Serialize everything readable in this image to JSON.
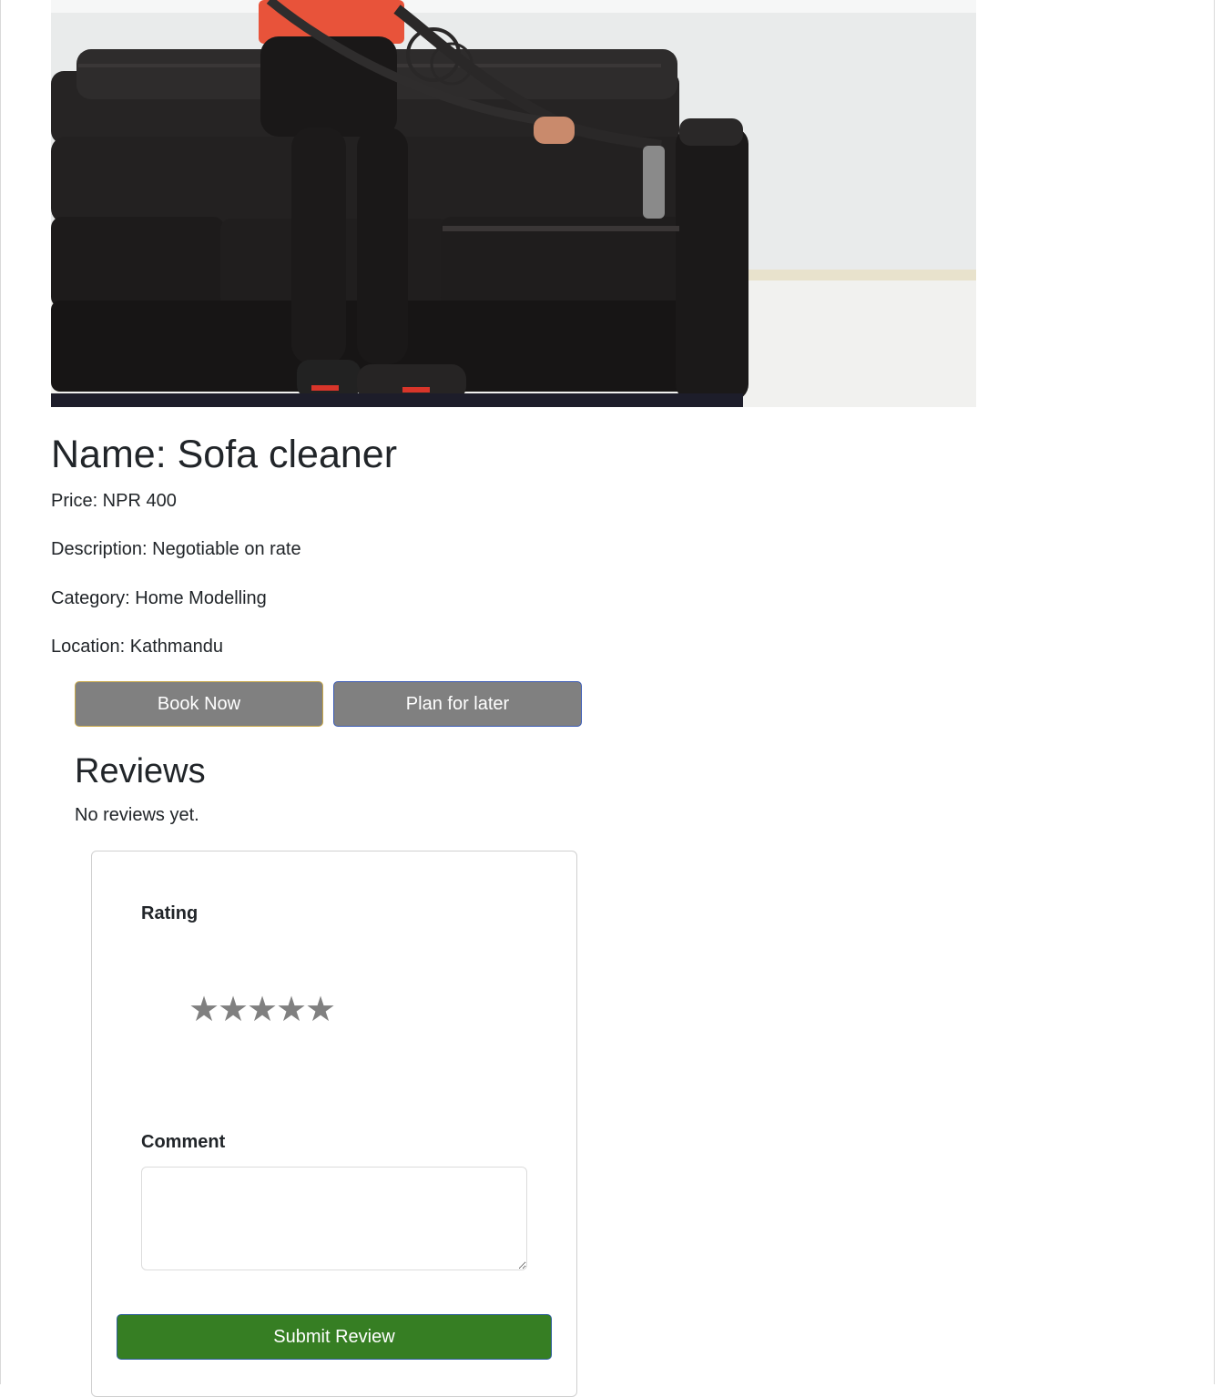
{
  "product": {
    "name": "Name: Sofa cleaner",
    "price": "Price: NPR 400",
    "description": "Description: Negotiable on rate",
    "category": "Category: Home Modelling",
    "location": "Location: Kathmandu"
  },
  "actions": {
    "book_label": "Book Now",
    "plan_label": "Plan for later"
  },
  "reviews": {
    "title": "Reviews",
    "empty_text": "No reviews yet."
  },
  "review_form": {
    "rating_label": "Rating",
    "stars": [
      "★",
      "★",
      "★",
      "★",
      "★"
    ],
    "comment_label": "Comment",
    "comment_value": "",
    "submit_label": "Submit Review"
  },
  "colors": {
    "button_gray": "#808080",
    "submit_green": "#367e23",
    "star_gray": "#808080"
  }
}
